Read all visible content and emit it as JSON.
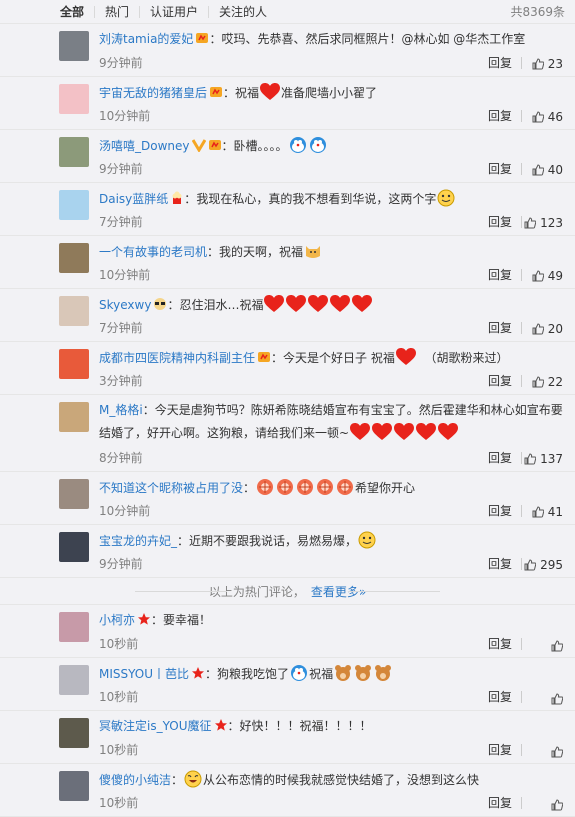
{
  "tabs": [
    "全部",
    "热门",
    "认证用户",
    "关注的人"
  ],
  "total": "共8369条",
  "divider": {
    "text": "以上为热门评论，",
    "more": "查看更多»"
  },
  "comments": [
    {
      "user": "刘涛tamia的爱妃",
      "text": "哎玛、先恭喜、然后求同框照片！@林心如 @华杰工作室",
      "time": "9分钟前",
      "reply": "回复",
      "likes": "23"
    },
    {
      "user": "宇宙无敌的猪猪皇后",
      "text_a": "祝福",
      "text_b": "准备爬墙小小翟了",
      "time": "10分钟前",
      "reply": "回复",
      "likes": "46"
    },
    {
      "user": "汤嘻嘻_Downey",
      "text": "卧槽。。。。",
      "time": "9分钟前",
      "reply": "回复",
      "likes": "40"
    },
    {
      "user": "Daisy蓝胖纸",
      "text": "我现在私心，真的我不想看到华说，这两个字",
      "time": "7分钟前",
      "reply": "回复",
      "likes": "123"
    },
    {
      "user": "一个有故事的老司机",
      "text": "我的天啊，祝福",
      "time": "10分钟前",
      "reply": "回复",
      "likes": "49"
    },
    {
      "user": "Skyexwy",
      "text": "忍住泪水…祝福",
      "time": "7分钟前",
      "reply": "回复",
      "likes": "20"
    },
    {
      "user": "成都市四医院精神内科副主任",
      "text_a": "今天是个好日子  祝福",
      "text_b": "（胡歌粉来过）",
      "time": "3分钟前",
      "reply": "回复",
      "likes": "22"
    },
    {
      "user": "M_格格i",
      "text": "今天是虐狗节吗？陈妍希陈晓结婚宣布有宝宝了。然后霍建华和林心如宣布要结婚了，好开心啊。这狗粮，请给我们来一顿~",
      "time": "8分钟前",
      "reply": "回复",
      "likes": "137"
    },
    {
      "user": "不知道这个昵称被占用了没",
      "text": "希望你开心",
      "time": "10分钟前",
      "reply": "回复",
      "likes": "41"
    },
    {
      "user": "宝宝龙的卉妃_",
      "text": "近期不要跟我说话，易燃易爆，",
      "time": "9分钟前",
      "reply": "回复",
      "likes": "295"
    }
  ],
  "recent": [
    {
      "user": "小柯亦",
      "text": "要幸福！",
      "time": "10秒前",
      "reply": "回复"
    },
    {
      "user": "MISSYOU丨芭比",
      "text_a": "狗粮我吃饱了",
      "text_b": "祝福",
      "time": "10秒前",
      "reply": "回复"
    },
    {
      "user": "冥敏注定is_YOU魔征",
      "text": "好快！！！祝福！！！！",
      "time": "10秒前",
      "reply": "回复"
    },
    {
      "user": "傻傻的小纯洁",
      "text": "从公布恋情的时候我就感觉快结婚了，没想到这么快",
      "time": "10秒前",
      "reply": "回复"
    }
  ]
}
